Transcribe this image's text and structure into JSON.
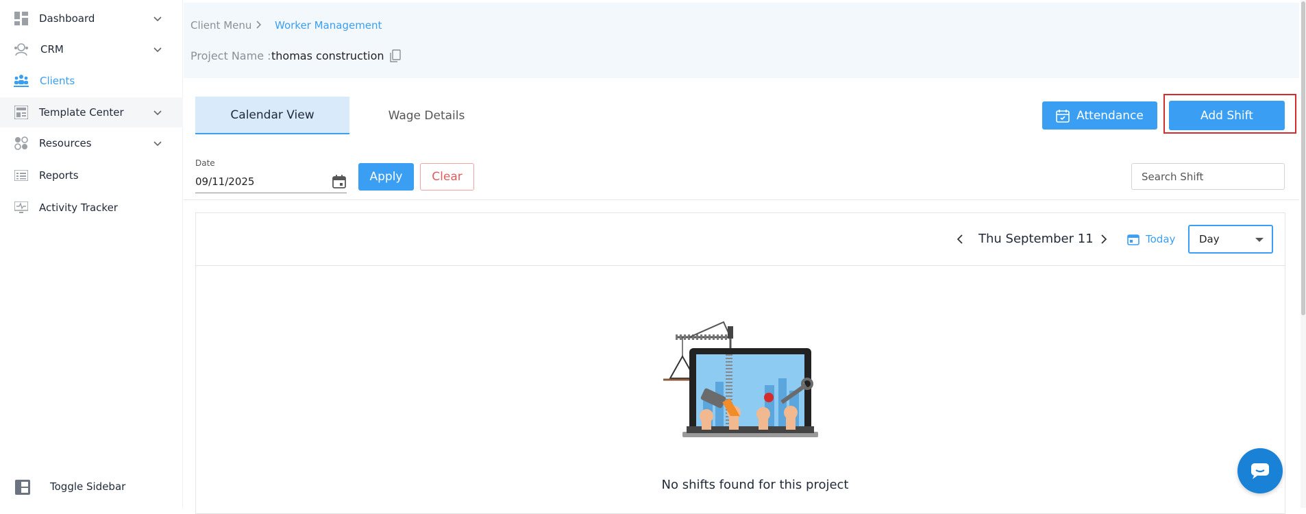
{
  "sidebar": {
    "items": [
      {
        "label": "Dashboard",
        "icon": "dashboard-icon",
        "has_chevron": true
      },
      {
        "label": "CRM",
        "icon": "crm-icon",
        "has_chevron": true
      },
      {
        "label": "Clients",
        "icon": "clients-icon",
        "has_chevron": false,
        "active": true
      },
      {
        "label": "Template Center",
        "icon": "template-center-icon",
        "has_chevron": true
      },
      {
        "label": "Resources",
        "icon": "resources-icon",
        "has_chevron": true
      },
      {
        "label": "Reports",
        "icon": "reports-icon",
        "has_chevron": false
      },
      {
        "label": "Activity Tracker",
        "icon": "activity-tracker-icon",
        "has_chevron": false
      }
    ],
    "toggle_label": "Toggle Sidebar"
  },
  "breadcrumb": {
    "parent": "Client Menu",
    "current": "Worker Management"
  },
  "project": {
    "label": "Project Name :",
    "value": "thomas construction"
  },
  "tabs": [
    {
      "label": "Calendar View",
      "active": true
    },
    {
      "label": "Wage Details",
      "active": false
    }
  ],
  "actions": {
    "attendance_label": "Attendance",
    "add_shift_label": "Add Shift"
  },
  "filter": {
    "date_label": "Date",
    "date_value": "09/11/2025",
    "apply_label": "Apply",
    "clear_label": "Clear",
    "search_placeholder": "Search Shift"
  },
  "calendar": {
    "current_date": "Thu September 11",
    "today_label": "Today",
    "view_value": "Day",
    "empty_message": "No shifts found for this project"
  },
  "colors": {
    "accent": "#3a9ff2",
    "clear": "#e25c5c",
    "highlight_border": "#d62b2b",
    "chat": "#1a82d6"
  }
}
